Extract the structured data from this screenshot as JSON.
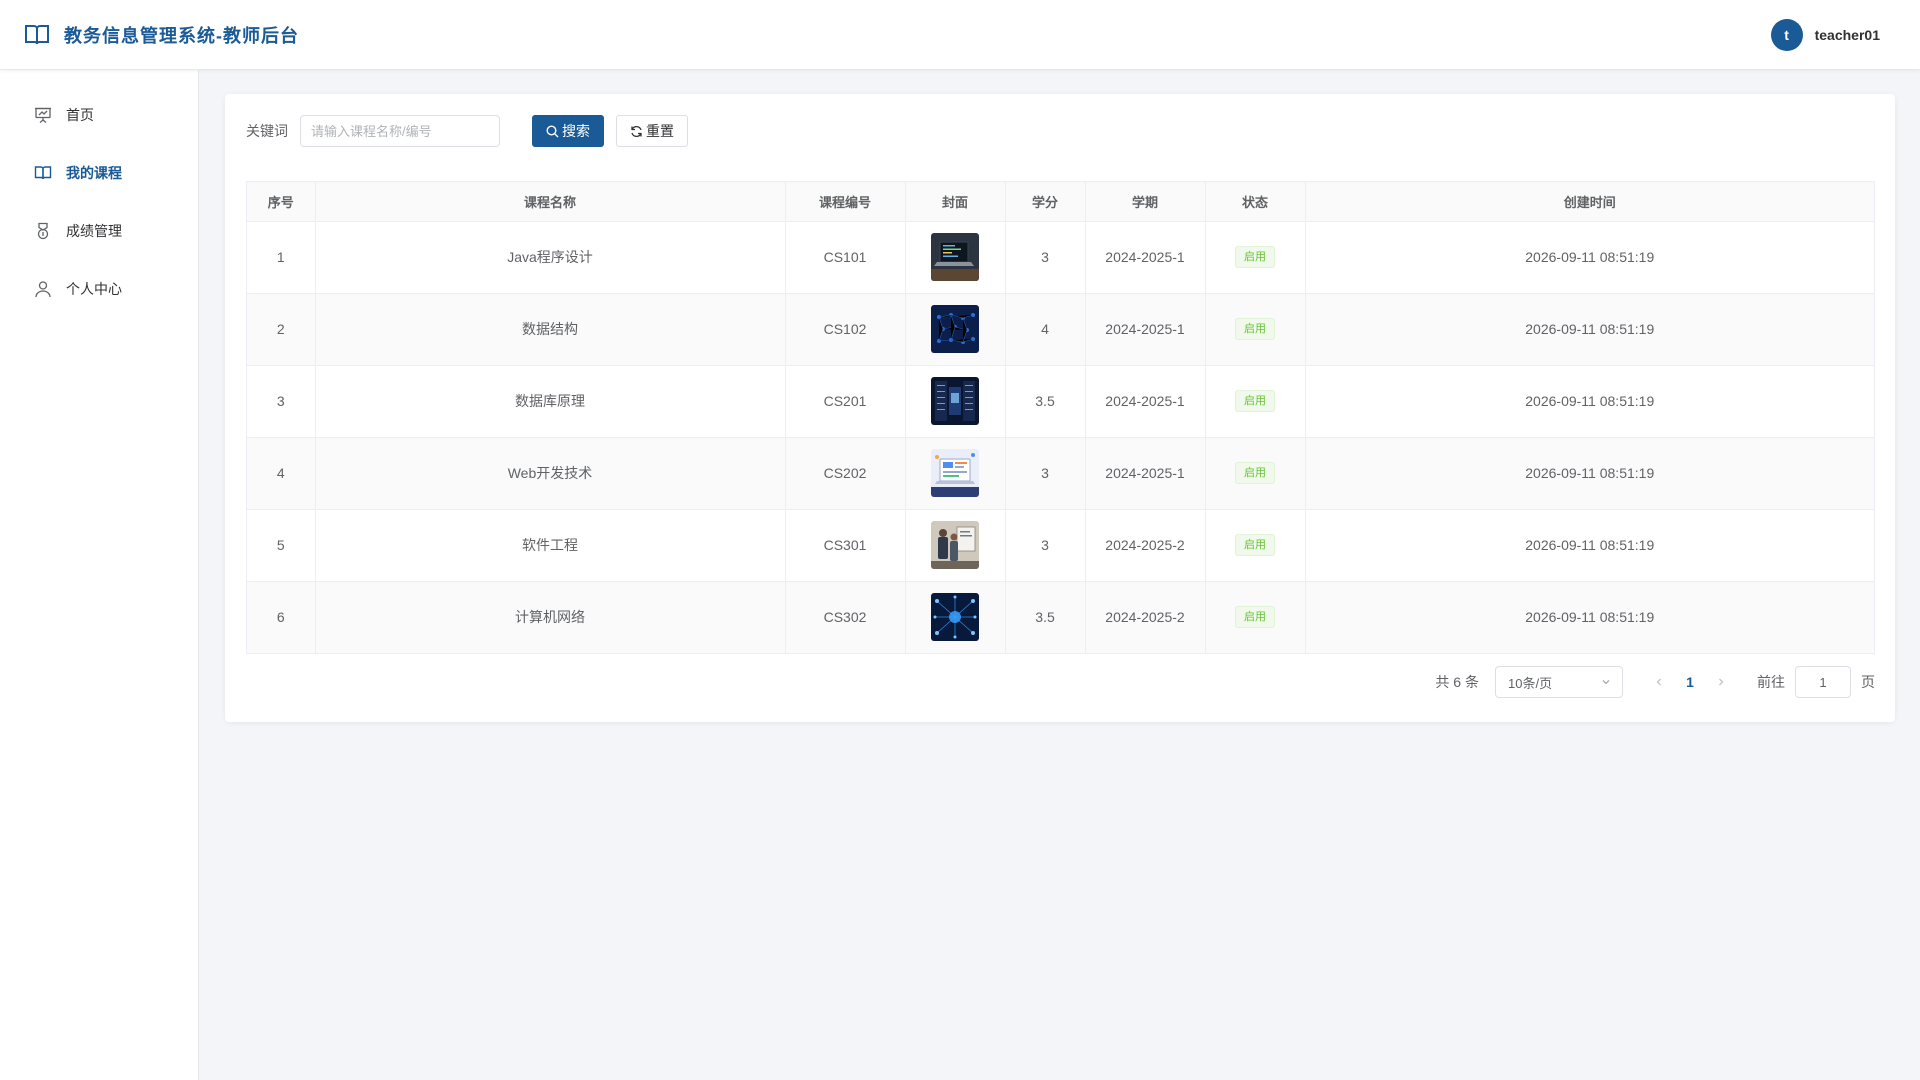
{
  "header": {
    "title": "教务信息管理系统-教师后台",
    "avatar_initial": "t",
    "username": "teacher01"
  },
  "sidebar": {
    "items": [
      {
        "label": "首页",
        "icon": "presentation-icon",
        "active": false
      },
      {
        "label": "我的课程",
        "icon": "book-icon",
        "active": true
      },
      {
        "label": "成绩管理",
        "icon": "medal-icon",
        "active": false
      },
      {
        "label": "个人中心",
        "icon": "user-icon",
        "active": false
      }
    ]
  },
  "search": {
    "label": "关键词",
    "placeholder": "请输入课程名称/编号",
    "search_button": "搜索",
    "reset_button": "重置"
  },
  "table": {
    "columns": [
      "序号",
      "课程名称",
      "课程编号",
      "封面",
      "学分",
      "学期",
      "状态",
      "创建时间"
    ],
    "rows": [
      {
        "index": "1",
        "name": "Java程序设计",
        "code": "CS101",
        "cover": "laptop-code",
        "credit": "3",
        "term": "2024-2025-1",
        "status": "启用",
        "created": "2026-09-11 08:51:19"
      },
      {
        "index": "2",
        "name": "数据结构",
        "code": "CS102",
        "cover": "network-grid",
        "credit": "4",
        "term": "2024-2025-1",
        "status": "启用",
        "created": "2026-09-11 08:51:19"
      },
      {
        "index": "3",
        "name": "数据库原理",
        "code": "CS201",
        "cover": "server-room",
        "credit": "3.5",
        "term": "2024-2025-1",
        "status": "启用",
        "created": "2026-09-11 08:51:19"
      },
      {
        "index": "4",
        "name": "Web开发技术",
        "code": "CS202",
        "cover": "web-dashboard",
        "credit": "3",
        "term": "2024-2025-1",
        "status": "启用",
        "created": "2026-09-11 08:51:19"
      },
      {
        "index": "5",
        "name": "软件工程",
        "code": "CS301",
        "cover": "team-meeting",
        "credit": "3",
        "term": "2024-2025-2",
        "status": "启用",
        "created": "2026-09-11 08:51:19"
      },
      {
        "index": "6",
        "name": "计算机网络",
        "code": "CS302",
        "cover": "network-globe",
        "credit": "3.5",
        "term": "2024-2025-2",
        "status": "启用",
        "created": "2026-09-11 08:51:19"
      }
    ]
  },
  "pagination": {
    "total_text": "共 6 条",
    "page_size": "10条/页",
    "current_page": "1",
    "goto_label": "前往",
    "goto_value": "1",
    "goto_unit": "页"
  },
  "colors": {
    "primary": "#1a5a96",
    "success_text": "#67c23a",
    "success_bg": "#f0f9eb",
    "background": "#f3f5f8"
  }
}
